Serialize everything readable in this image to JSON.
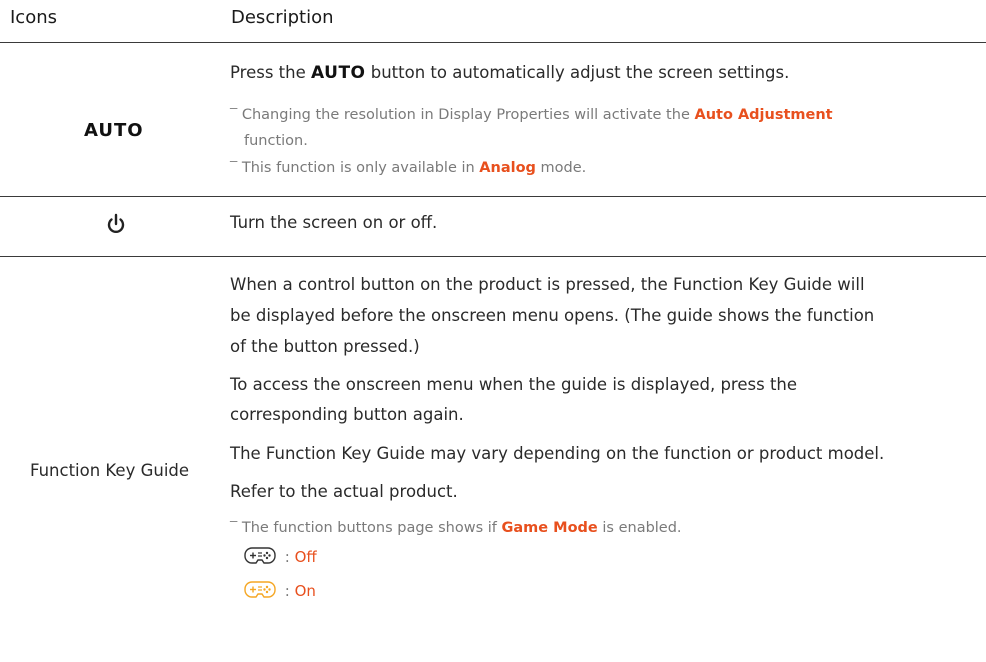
{
  "header": {
    "col1": "Icons",
    "col2": "Description"
  },
  "auto_row": {
    "icon_text": "AUTO",
    "line1_pre": "Press the ",
    "line1_key": "AUTO",
    "line1_post": " button to automatically adjust the screen settings.",
    "note1_pre": "Changing the resolution in Display Properties will activate the ",
    "note1_hl": "Auto Adjustment",
    "note1_cont": "function.",
    "note2_pre": "This function is only available in ",
    "note2_hl": "Analog",
    "note2_post": " mode."
  },
  "power_row": {
    "icon": "power-icon",
    "text": "Turn the screen on or off."
  },
  "guide_row": {
    "label": "Function Key Guide",
    "p1_l1": "When a control button on the product is pressed, the Function Key Guide will",
    "p1_l2": "be displayed before the onscreen menu opens. (The guide shows the function",
    "p1_l3": "of the button pressed.)",
    "p2_l1": "To access the onscreen menu when the guide is displayed, press the",
    "p2_l2": "corresponding button again.",
    "p3": "The Function Key Guide may vary depending on the function or product model.",
    "p4": "Refer to the actual product.",
    "note_pre": "The function buttons page shows if ",
    "note_hl": "Game Mode",
    "note_post": " is enabled.",
    "off_sep": " : ",
    "off_label": "Off",
    "on_sep": " : ",
    "on_label": "On",
    "off_icon_color": "#333333",
    "on_icon_color": "#f5a623"
  },
  "colors": {
    "highlight": "#e8501e",
    "note_text": "#7a7a7a",
    "rule": "#3a3a3a"
  }
}
